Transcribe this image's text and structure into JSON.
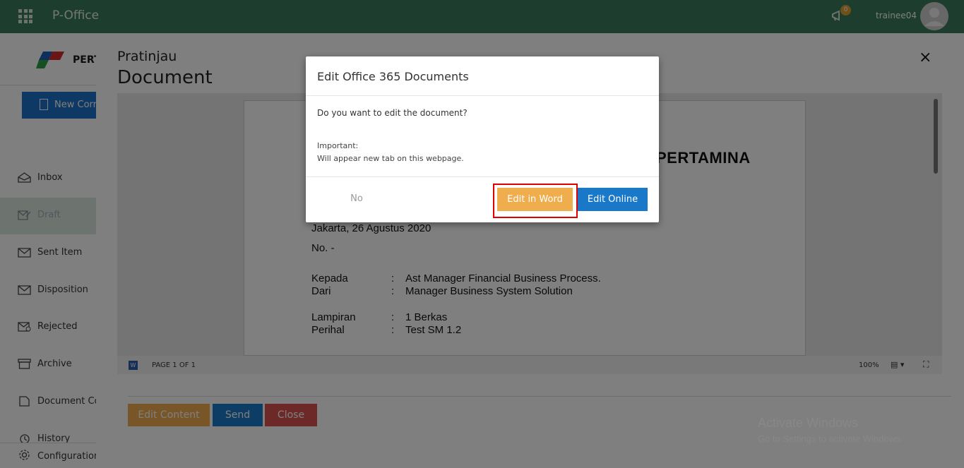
{
  "app": {
    "title": "P-Office"
  },
  "header": {
    "notification_count": "0",
    "username": "trainee04"
  },
  "sidebar": {
    "logo_text": "PERT",
    "new_button_label": "New Correspondence",
    "items": [
      {
        "label": "Inbox",
        "icon": "inbox-icon"
      },
      {
        "label": "Draft",
        "icon": "draft-icon"
      },
      {
        "label": "Sent Item",
        "icon": "sent-icon"
      },
      {
        "label": "Disposition",
        "icon": "disposition-icon"
      },
      {
        "label": "Rejected",
        "icon": "rejected-icon"
      },
      {
        "label": "Archive",
        "icon": "archive-icon"
      },
      {
        "label": "Document Control",
        "icon": "document-control-icon"
      },
      {
        "label": "History",
        "icon": "history-icon"
      },
      {
        "label": "Configuration",
        "icon": "gear-icon"
      }
    ]
  },
  "main": {
    "title_small": "Pratinjau",
    "title_big": "Document",
    "close_label": "×",
    "document": {
      "brand": "PERTAMINA",
      "date_line": "Jakarta, 26 Agustus 2020",
      "number_line": "No. -",
      "fields": [
        {
          "label": "Kepada",
          "sep": ":",
          "value": "Ast Manager Financial Business Process."
        },
        {
          "label": "Dari",
          "sep": ":",
          "value": "Manager Business System Solution"
        },
        {
          "label": "Lampiran",
          "sep": ":",
          "value": "1 Berkas"
        },
        {
          "label": "Perihal",
          "sep": ":",
          "value": "Test SM 1.2"
        }
      ]
    },
    "status_bar": {
      "page_info": "PAGE 1 OF 1",
      "zoom": "100%"
    },
    "actions": {
      "edit_content": "Edit Content",
      "send": "Send",
      "close": "Close"
    }
  },
  "watermark": {
    "line1": "Activate Windows",
    "line2": "Go to Settings to activate Windows."
  },
  "modal": {
    "title": "Edit Office 365 Documents",
    "question": "Do you want to edit the document?",
    "important": "Important:",
    "note": "Will appear new tab on this webpage.",
    "no_label": "No",
    "edit_word_label": "Edit in Word",
    "edit_online_label": "Edit Online"
  },
  "colors": {
    "topbar": "#3a7a5c",
    "primary": "#1a78c8",
    "warning": "#f0ad4e",
    "danger": "#d9534f",
    "highlight": "#e00000"
  }
}
